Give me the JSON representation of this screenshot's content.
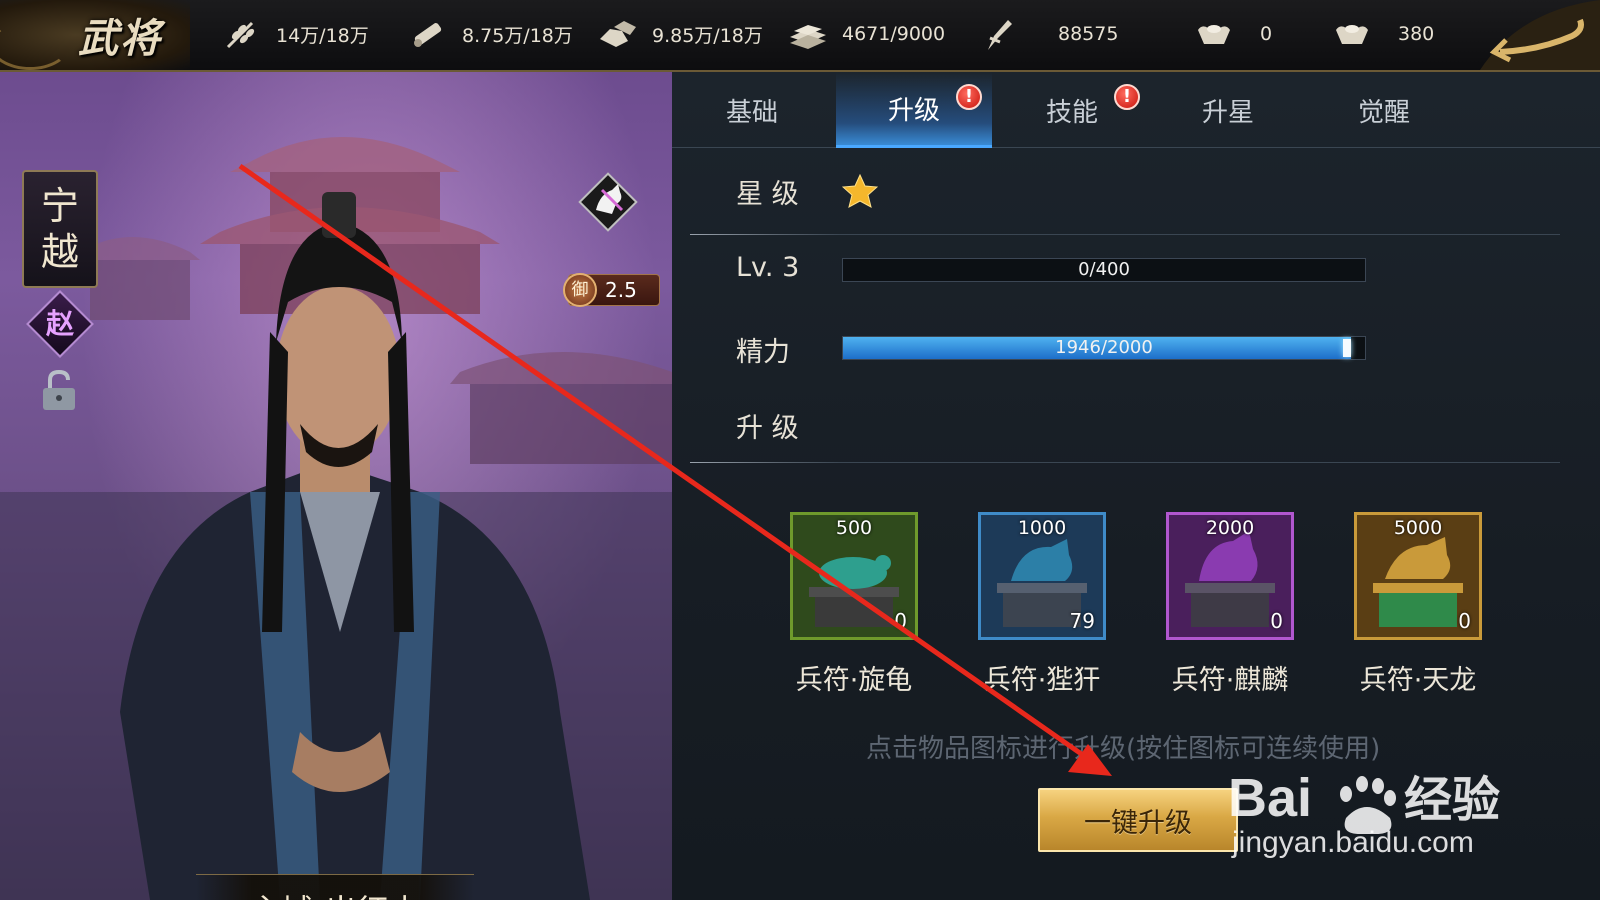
{
  "header": {
    "title": "武将",
    "resources": [
      {
        "icon": "grain-icon",
        "value": "14万/18万"
      },
      {
        "icon": "wood-icon",
        "value": "8.75万/18万"
      },
      {
        "icon": "stone-icon",
        "value": "9.85万/18万"
      },
      {
        "icon": "iron-icon",
        "value": "4671/9000"
      },
      {
        "icon": "decree-icon",
        "value": "88575"
      },
      {
        "icon": "gold-ingot-icon",
        "value": "0"
      },
      {
        "icon": "silver-ingot-icon",
        "value": "380"
      }
    ]
  },
  "general": {
    "name_char_1": "宁",
    "name_char_2": "越",
    "faction": "赵",
    "defense_label": "御",
    "defense_value": "2.5",
    "status": "主城-出征中"
  },
  "tabs": [
    {
      "label": "基础",
      "active": false,
      "alert": false
    },
    {
      "label": "升级",
      "active": true,
      "alert": true
    },
    {
      "label": "技能",
      "active": false,
      "alert": true
    },
    {
      "label": "升星",
      "active": false,
      "alert": false
    },
    {
      "label": "觉醒",
      "active": false,
      "alert": false
    }
  ],
  "alert_mark": "!",
  "stats": {
    "star_label": "星 级",
    "star_count": 1,
    "level_label": "Lv. 3",
    "exp_text": "0/400",
    "exp_fraction": 0.0,
    "energy_label": "精力",
    "energy_text": "1946/2000",
    "energy_fraction": 0.973,
    "upgrade_label": "升 级"
  },
  "items": [
    {
      "name": "兵符·旋龟",
      "cost": "500",
      "count": "0",
      "frame": "#6f9a2c",
      "bg": "#2f4a1c"
    },
    {
      "name": "兵符·狴犴",
      "cost": "1000",
      "count": "79",
      "frame": "#3f8bc8",
      "bg": "#1d3a58"
    },
    {
      "name": "兵符·麒麟",
      "cost": "2000",
      "count": "0",
      "frame": "#b157cf",
      "bg": "#4a1f5c"
    },
    {
      "name": "兵符·天龙",
      "cost": "5000",
      "count": "0",
      "frame": "#c99a3a",
      "bg": "#5a3e14"
    }
  ],
  "hint": "点击物品图标进行升级(按住图标可连续使用)",
  "one_click_label": "一键升级",
  "watermark": {
    "brand": "Baidu经验",
    "url": "jingyan.baidu.com"
  },
  "colors": {
    "accent_blue": "#4aa8ff",
    "gold_button": "#d9a845",
    "annotation_arrow": "#e8281c"
  }
}
